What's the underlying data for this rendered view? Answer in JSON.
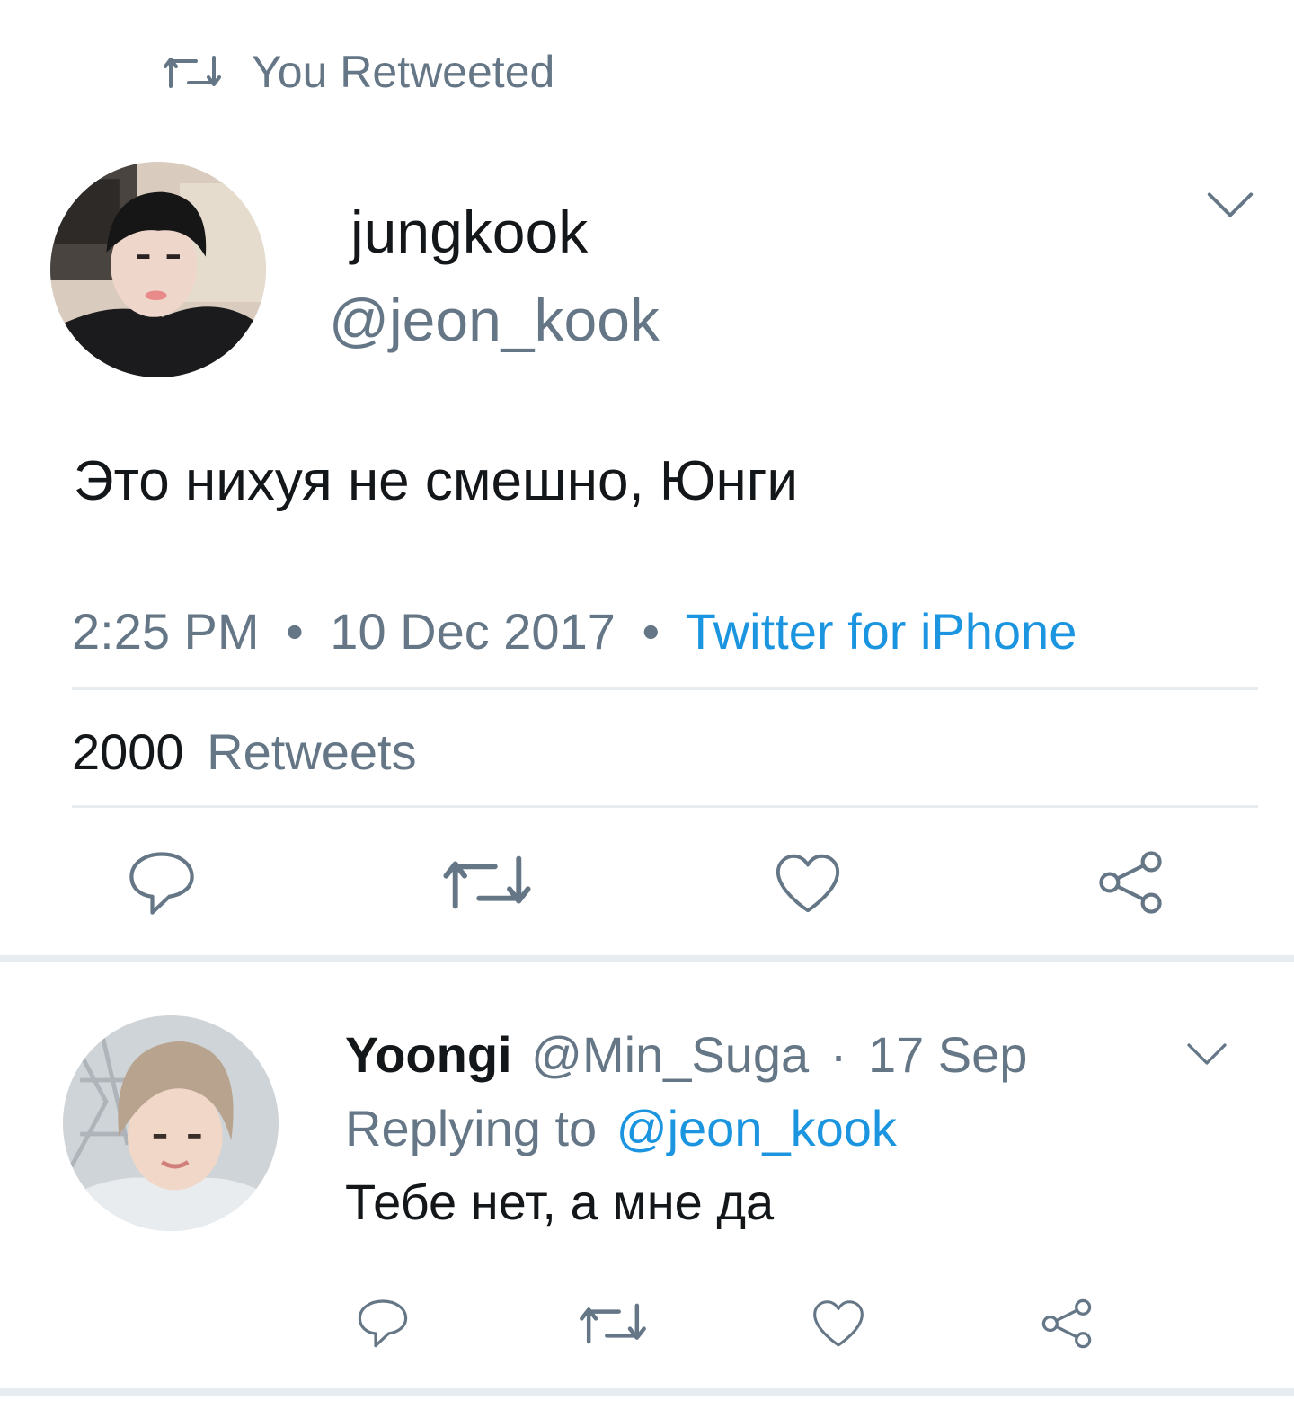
{
  "retweet_banner": {
    "text": "You Retweeted",
    "icon": "retweet-icon"
  },
  "main_tweet": {
    "name": "jungkook",
    "handle": "@jeon_kook",
    "text": "Это нихуя не смешно, Юнги",
    "time": "2:25 PM",
    "separator": "•",
    "date": "10 Dec 2017",
    "source": "Twitter for iPhone",
    "stats": {
      "count": "2000",
      "label": "Retweets"
    },
    "actions": [
      "reply-icon",
      "retweet-icon",
      "like-icon",
      "share-icon"
    ],
    "menu_icon": "chevron-down-icon"
  },
  "reply_tweet": {
    "name": "Yoongi",
    "handle": "@Min_Suga",
    "separator": "·",
    "date": "17 Sep",
    "replying_prefix": "Replying to",
    "replying_handle": "@jeon_kook",
    "text": "Тебе нет, а мне да",
    "actions": [
      "reply-icon",
      "retweet-icon",
      "like-icon",
      "share-icon"
    ],
    "menu_icon": "chevron-down-icon"
  },
  "colors": {
    "link": "#1b95e0",
    "muted": "#657786",
    "text": "#14171a",
    "divider": "#e6ecf0"
  }
}
